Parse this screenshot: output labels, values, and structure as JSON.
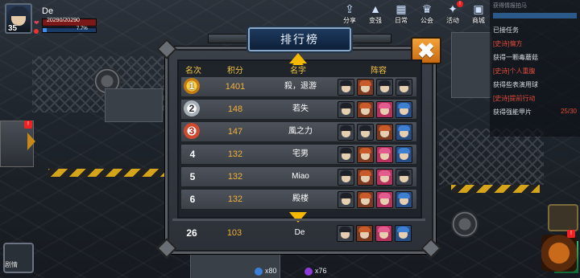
{
  "player": {
    "name": "De",
    "level": "35",
    "hp": "20290/20290",
    "xp_percent": "7.7%",
    "xp_fraction": 0.077
  },
  "topmenu": [
    {
      "label": "分享",
      "icon": "share-icon",
      "badge": ""
    },
    {
      "label": "变强",
      "icon": "power-up-icon",
      "badge": ""
    },
    {
      "label": "日常",
      "icon": "daily-icon",
      "badge": ""
    },
    {
      "label": "公会",
      "icon": "guild-icon",
      "badge": ""
    },
    {
      "label": "活动",
      "icon": "event-icon",
      "badge": "!"
    },
    {
      "label": "商城",
      "icon": "shop-icon",
      "badge": ""
    }
  ],
  "quest_panel": {
    "header": "获得情报拍马",
    "items": [
      {
        "text": "已接任务",
        "style": "white",
        "tail": ""
      },
      {
        "text": "[史诗]偏方",
        "style": "red",
        "tail": ""
      },
      {
        "text": "获得一颗毒蘑菇",
        "style": "white",
        "tail": ""
      },
      {
        "text": "[史诗]个人重腹",
        "style": "red",
        "tail": ""
      },
      {
        "text": "获得些表演用球",
        "style": "white",
        "tail": ""
      },
      {
        "text": "[史诗]提前行动",
        "style": "red",
        "tail": ""
      },
      {
        "text": "获得强能甲片",
        "style": "white",
        "tail": "25/30"
      }
    ]
  },
  "side": {
    "bottom_left_label": "剧情",
    "badge": "!"
  },
  "bottom_counters": [
    {
      "value": "x80",
      "color": "#3a7fd8"
    },
    {
      "value": "x76",
      "color": "#8a3ad8"
    }
  ],
  "leaderboard": {
    "title": "排行榜",
    "close": "✖",
    "columns": {
      "rank": "名次",
      "score": "积分",
      "name": "名字",
      "team": "阵容"
    },
    "rows": [
      {
        "rank": "1",
        "medal": "gold",
        "score": "1401",
        "name": "殺，退游",
        "team": [
          "dark",
          "brown",
          "dark",
          "dark"
        ]
      },
      {
        "rank": "2",
        "medal": "silver",
        "score": "148",
        "name": "若失",
        "team": [
          "dark",
          "brown",
          "pink",
          "blue"
        ]
      },
      {
        "rank": "3",
        "medal": "bronze",
        "score": "147",
        "name": "風之力",
        "team": [
          "dark",
          "dark",
          "brown",
          "blue"
        ]
      },
      {
        "rank": "4",
        "medal": "",
        "score": "132",
        "name": "宅男",
        "team": [
          "dark",
          "brown",
          "pink",
          "blue"
        ]
      },
      {
        "rank": "5",
        "medal": "",
        "score": "132",
        "name": "Miao",
        "team": [
          "dark",
          "brown",
          "pink",
          "dark"
        ]
      },
      {
        "rank": "6",
        "medal": "",
        "score": "132",
        "name": "殿楼",
        "team": [
          "dark",
          "brown",
          "pink",
          "blue"
        ]
      }
    ],
    "me": {
      "rank": "26",
      "score": "103",
      "name": "De",
      "team": [
        "dark",
        "brown",
        "pink",
        "blue"
      ]
    }
  }
}
